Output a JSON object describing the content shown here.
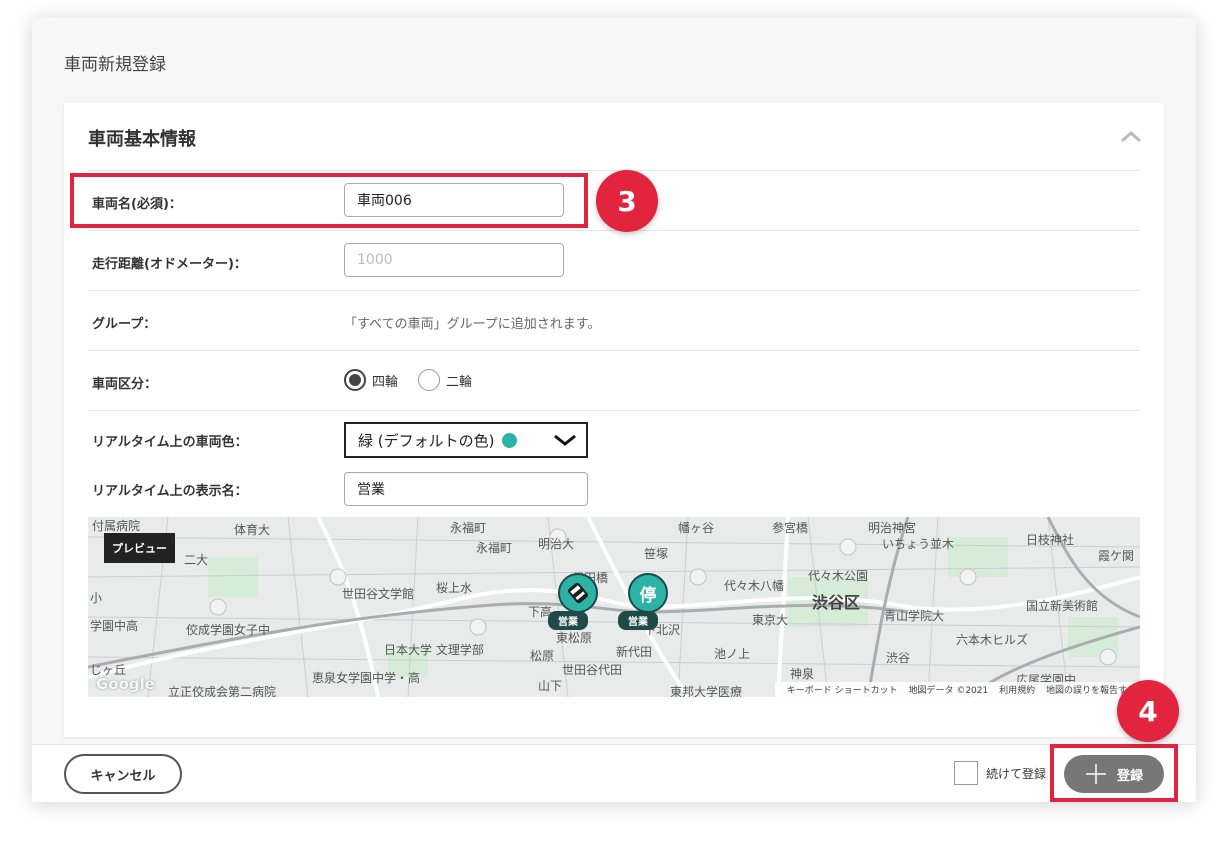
{
  "dialog": {
    "title": "車両新規登録"
  },
  "section": {
    "title": "車両基本情報"
  },
  "fields": {
    "name": {
      "label": "車両名(必須)：",
      "value": "車両006"
    },
    "odometer": {
      "label": "走行距離(オドメーター)：",
      "placeholder": "1000"
    },
    "group": {
      "label": "グループ：",
      "text": "「すべての車両」グループに追加されます。"
    },
    "category": {
      "label": "車両区分：",
      "options": [
        "四輪",
        "二輪"
      ],
      "selected": "四輪"
    },
    "color": {
      "label": "リアルタイム上の車両色：",
      "value": "緑 (デフォルトの色)",
      "swatch": "#2bb3a6"
    },
    "display_name": {
      "label": "リアルタイム上の表示名：",
      "value": "営業"
    }
  },
  "map": {
    "preview_label": "プレビュー",
    "labels": {
      "fuzoku": "付属病院",
      "taiikudai": "体育大",
      "ni": "二大",
      "ko": "小",
      "gakuen": "学園中高",
      "koseigakuen": "佼成学園女子中",
      "gaoka": "じヶ丘",
      "risshokai": "立正佼成会第二病院",
      "setagaya": "世田谷文学館",
      "sakura": "桜上水",
      "nihon": "日本大学 文理学部",
      "matsubara": "松原",
      "keisen": "恵泉女学園中学・高",
      "eifuku": "永福町",
      "eifukucho": "永福町",
      "meidai": "明治大",
      "daita": "代田橋",
      "sasazuka": "笹塚",
      "shimotaka": "下高",
      "higashi": "東松原",
      "shindaita": "新代田",
      "setagayadaita": "世田谷代田",
      "shimokita": "下北沢",
      "yamashita": "山下",
      "hatagaya": "幡ヶ谷",
      "yoyogihachiman": "代々木八幡",
      "yoyogi": "代々木公園",
      "tokyodai": "東京大",
      "ikenoue": "池ノ上",
      "shinsen": "神泉",
      "shibuyaku": "渋谷区",
      "aoyama": "青山学院大",
      "sangubashi": "参宮橋",
      "meiji": "明治神宮",
      "icho": "いちょう並木",
      "hie": "日枝神社",
      "kokuritsu": "国立新美術館",
      "roppongi": "六本木ヒルズ",
      "shibuya": "渋谷",
      "toho": "東邦大学医療",
      "hiroo": "広尾学園中",
      "kasumi": "霞ケ関"
    },
    "markers": [
      {
        "label": "営業",
        "color": "#2bb3a6"
      },
      {
        "label": "営業",
        "glyph": "停",
        "color": "#2bb3a6"
      }
    ],
    "google": "Google",
    "attribution": [
      "キーボード ショートカット",
      "地図データ ©2021",
      "利用規約",
      "地図の誤りを報告する"
    ]
  },
  "footer": {
    "cancel": "キャンセル",
    "continue": "続けて登録",
    "register": "登録"
  },
  "annotations": {
    "step3": "3",
    "step4": "4"
  },
  "colors": {
    "accent": "#e2243e",
    "vehicle_green": "#2bb3a6",
    "marker_tag": "#1e4a48"
  }
}
